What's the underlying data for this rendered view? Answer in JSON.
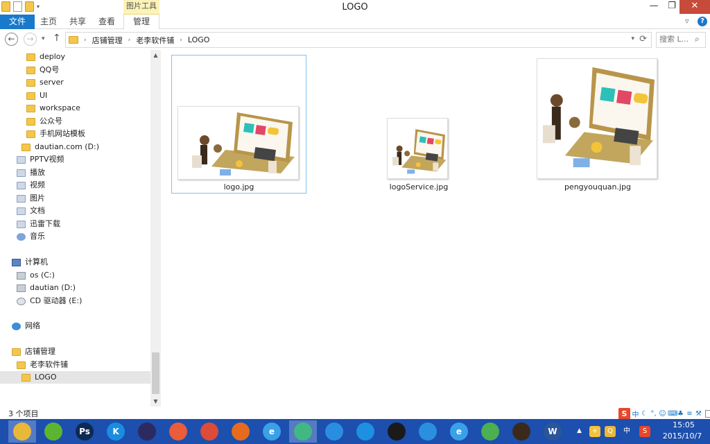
{
  "window": {
    "title": "LOGO",
    "contextual_tab_group": "图片工具",
    "controls": {
      "minimize": "—",
      "maximize": "❐",
      "close": "✕"
    }
  },
  "ribbon": {
    "tabs": [
      {
        "label": "文件"
      },
      {
        "label": "主页"
      },
      {
        "label": "共享"
      },
      {
        "label": "查看"
      },
      {
        "label": "管理"
      }
    ],
    "help": "?"
  },
  "address": {
    "breadcrumb": [
      "店铺管理",
      "老李软件铺",
      "LOGO"
    ],
    "separator": "›"
  },
  "search": {
    "placeholder": "搜索 L..."
  },
  "nav_pane": {
    "items": [
      {
        "label": "deploy",
        "icon": "folder"
      },
      {
        "label": "QQ号",
        "icon": "folder"
      },
      {
        "label": "server",
        "icon": "folder"
      },
      {
        "label": "UI",
        "icon": "folder"
      },
      {
        "label": "workspace",
        "icon": "folder"
      },
      {
        "label": "公众号",
        "icon": "folder"
      },
      {
        "label": "手机网站模板",
        "icon": "folder"
      },
      {
        "label": "dautian.com (D:)",
        "icon": "folder"
      },
      {
        "label": "PPTV视频",
        "icon": "library"
      },
      {
        "label": "播放",
        "icon": "library"
      },
      {
        "label": "视频",
        "icon": "library"
      },
      {
        "label": "图片",
        "icon": "library"
      },
      {
        "label": "文档",
        "icon": "library"
      },
      {
        "label": "迅雷下载",
        "icon": "library"
      },
      {
        "label": "音乐",
        "icon": "music"
      },
      {
        "label": "计算机",
        "icon": "computer"
      },
      {
        "label": "os (C:)",
        "icon": "drive"
      },
      {
        "label": "dautian (D:)",
        "icon": "drive"
      },
      {
        "label": "CD 驱动器 (E:)",
        "icon": "cd"
      },
      {
        "label": "网络",
        "icon": "network"
      },
      {
        "label": "店铺管理",
        "icon": "folder"
      },
      {
        "label": "老李软件铺",
        "icon": "folder"
      },
      {
        "label": "LOGO",
        "icon": "folder",
        "selected": true
      }
    ]
  },
  "files": [
    {
      "name": "logo.jpg",
      "selected": true
    },
    {
      "name": "logoService.jpg",
      "selected": false
    },
    {
      "name": "pengyouquan.jpg",
      "selected": false
    }
  ],
  "status": {
    "item_count": "3 个项目"
  },
  "ime": {
    "logo": "S",
    "mode": "中"
  },
  "taskbar": {
    "apps": [
      {
        "name": "file-explorer",
        "color": "#e8b83a",
        "glyph": "",
        "active": true
      },
      {
        "name": "360-browser",
        "color": "#5cb531",
        "glyph": ""
      },
      {
        "name": "photoshop",
        "color": "#0d2a52",
        "glyph": "Ps"
      },
      {
        "name": "kugou",
        "color": "#1a8de0",
        "glyph": "K"
      },
      {
        "name": "eclipse",
        "color": "#2c2a5e",
        "glyph": ""
      },
      {
        "name": "colorful-app",
        "color": "#e85d3a",
        "glyph": ""
      },
      {
        "name": "chrome",
        "color": "#dd4b39",
        "glyph": ""
      },
      {
        "name": "firefox",
        "color": "#e66b1f",
        "glyph": ""
      },
      {
        "name": "ie",
        "color": "#3aa0e8",
        "glyph": "e"
      },
      {
        "name": "xunlei",
        "color": "#41b883",
        "glyph": "",
        "active": true
      },
      {
        "name": "baidu-cloud",
        "color": "#2a8ee0",
        "glyph": ""
      },
      {
        "name": "network-app",
        "color": "#1f8fe0",
        "glyph": ""
      },
      {
        "name": "eye-app",
        "color": "#1a1a1a",
        "glyph": ""
      },
      {
        "name": "pen-app",
        "color": "#2b8fe0",
        "glyph": ""
      },
      {
        "name": "ie-2",
        "color": "#3aa0e8",
        "glyph": "e"
      },
      {
        "name": "wechat",
        "color": "#4caf50",
        "glyph": ""
      },
      {
        "name": "game-app",
        "color": "#3b2a1a",
        "glyph": ""
      },
      {
        "name": "word",
        "color": "#2a5699",
        "glyph": "W"
      }
    ]
  },
  "clock": {
    "time": "15:05",
    "date": "2015/10/7"
  }
}
